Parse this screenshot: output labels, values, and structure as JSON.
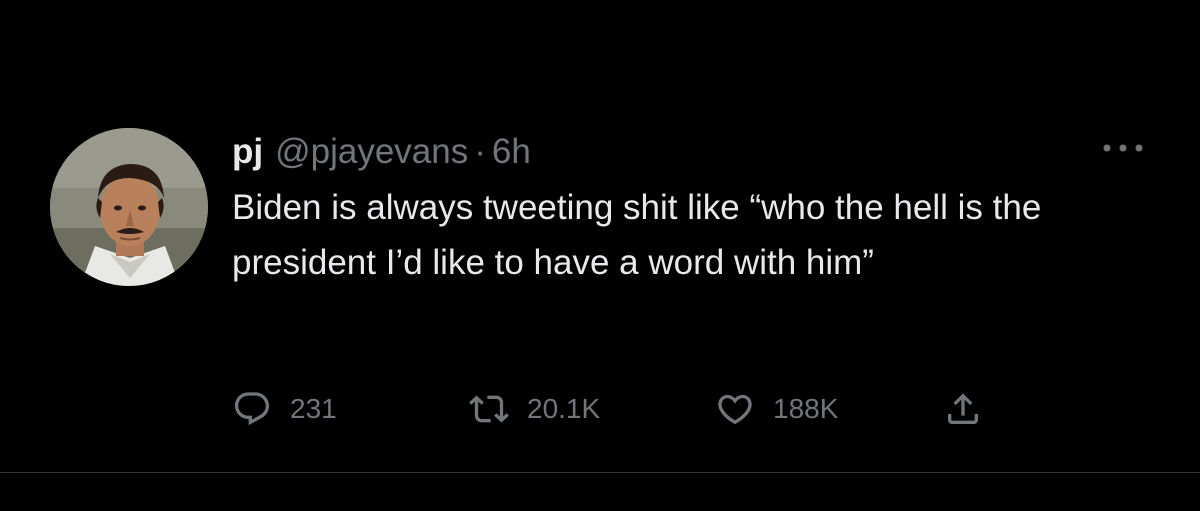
{
  "tweet": {
    "author_name": "pj",
    "author_handle": "@pjayevans",
    "separator": "·",
    "time": "6h",
    "text": "Biden is always tweeting shit like “who the hell is the president I’d like to have a word with him”",
    "more_icon": "more-horizontal-icon",
    "avatar": "profile-photo"
  },
  "actions": {
    "reply": {
      "icon": "reply-icon",
      "count": "231"
    },
    "retweet": {
      "icon": "retweet-icon",
      "count": "20.1K"
    },
    "like": {
      "icon": "heart-icon",
      "count": "188K"
    },
    "share": {
      "icon": "share-icon"
    }
  },
  "colors": {
    "background": "#000000",
    "primary_text": "#e7e9ea",
    "secondary_text": "#71767b",
    "divider": "#2f3336"
  }
}
